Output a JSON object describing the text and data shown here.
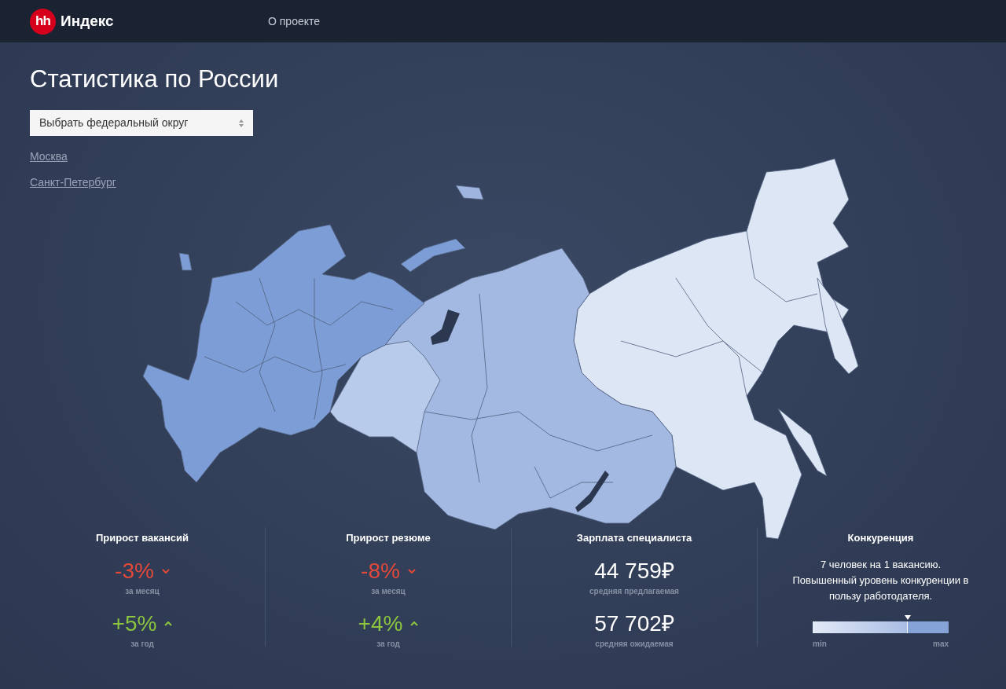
{
  "header": {
    "logo_mark": "hh",
    "logo_text": "Индекс",
    "nav": [
      {
        "label": "О проекте"
      }
    ]
  },
  "title": "Статистика по России",
  "district_select": {
    "value": "Выбрать федеральный округ"
  },
  "city_links": [
    "Москва",
    "Санкт-Петербург"
  ],
  "stats": [
    {
      "kind": "trend",
      "title": "Прирост вакансий",
      "items": [
        {
          "value": "-3%",
          "rising": false,
          "caption": "за месяц"
        },
        {
          "value": "+5%",
          "rising": true,
          "caption": "за год"
        }
      ]
    },
    {
      "kind": "trend",
      "title": "Прирост резюме",
      "items": [
        {
          "value": "-8%",
          "rising": false,
          "caption": "за месяц"
        },
        {
          "value": "+4%",
          "rising": true,
          "caption": "за год"
        }
      ]
    },
    {
      "kind": "salary",
      "title": "Зарплата специалиста",
      "items": [
        {
          "value": "44 759₽",
          "caption": "средняя предлагаемая"
        },
        {
          "value": "57 702₽",
          "caption": "средняя ожидаемая"
        }
      ]
    },
    {
      "kind": "competition",
      "title": "Конкуренция",
      "text": "7 человек на 1 вакансию. Повышенный уровень конкуренции в пользу работодателя.",
      "level": 0.7,
      "min_label": "min",
      "max_label": "max"
    }
  ]
}
